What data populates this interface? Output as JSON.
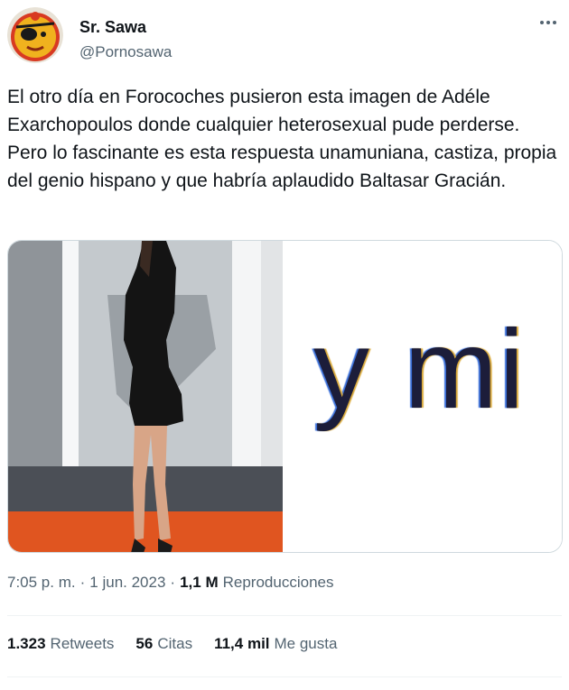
{
  "author": {
    "name": "Sr. Sawa",
    "handle": "@Pornosawa",
    "avatar_icon": "pirate-avatar-icon"
  },
  "more_icon": "more-options-icon",
  "tweet": {
    "text": "El otro día en Forocoches pusieron esta imagen de Adéle Exarchopoulos donde cualquier heterosexual pude perderse. Pero lo fascinante es esta respuesta unamuniana, castiza, propia del genio hispano y que habría aplaudido Baltasar Gracián."
  },
  "media": {
    "right_image_text": "y mi"
  },
  "meta": {
    "time": "7:05 p. m.",
    "separator": "·",
    "date": "1 jun. 2023",
    "views_count": "1,1 M",
    "views_label": "Reproducciones"
  },
  "stats": [
    {
      "count": "1.323",
      "label": "Retweets"
    },
    {
      "count": "56",
      "label": "Citas"
    },
    {
      "count": "11,4 mil",
      "label": "Me gusta"
    }
  ],
  "colors": {
    "text_primary": "#0f1419",
    "text_secondary": "#536471",
    "border": "#cfd9de",
    "carpet": "#e0541e"
  }
}
